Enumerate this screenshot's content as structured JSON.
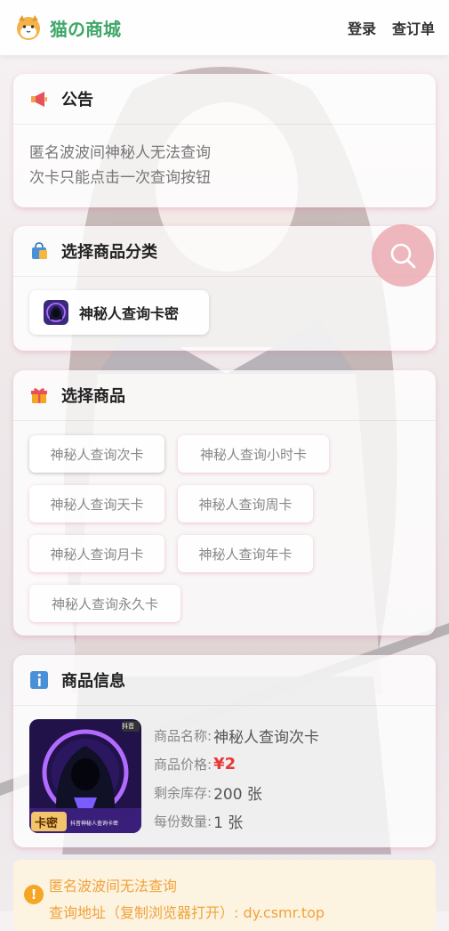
{
  "header": {
    "brand": "猫の商城",
    "nav": {
      "login": "登录",
      "check_order": "查订单"
    }
  },
  "notice": {
    "title": "公告",
    "lines": [
      "匿名波波间神秘人无法查询",
      "次卡只能点击一次查询按钮"
    ]
  },
  "category": {
    "title": "选择商品分类",
    "items": [
      {
        "label": "神秘人查询卡密",
        "icon": "hooded-figure-icon"
      }
    ]
  },
  "products": {
    "title": "选择商品",
    "items": [
      {
        "label": "神秘人查询次卡",
        "selected": true
      },
      {
        "label": "神秘人查询小时卡",
        "selected": false
      },
      {
        "label": "神秘人查询天卡",
        "selected": false
      },
      {
        "label": "神秘人查询周卡",
        "selected": false
      },
      {
        "label": "神秘人查询月卡",
        "selected": false
      },
      {
        "label": "神秘人查询年卡",
        "selected": false
      },
      {
        "label": "神秘人查询永久卡",
        "selected": false
      }
    ]
  },
  "product_info": {
    "title": "商品信息",
    "image": {
      "badge": "卡密",
      "corner": "抖音",
      "caption": "抖音神秘人查询卡密"
    },
    "name_label": "商品名称:",
    "name_value": "神秘人查询次卡",
    "price_label": "商品价格:",
    "price_value": "¥2",
    "stock_label": "剩余库存:",
    "stock_value": "200 张",
    "qty_label": "每份数量:",
    "qty_value": "1 张"
  },
  "bottom_notice": {
    "line1": "匿名波波间无法查询",
    "line2": "查询地址（复制浏览器打开）: dy.csmr.top"
  },
  "colors": {
    "brand": "#3ea769",
    "price": "#e53935",
    "warning": "#f0a33a",
    "card_glow": "#dc78aa"
  }
}
